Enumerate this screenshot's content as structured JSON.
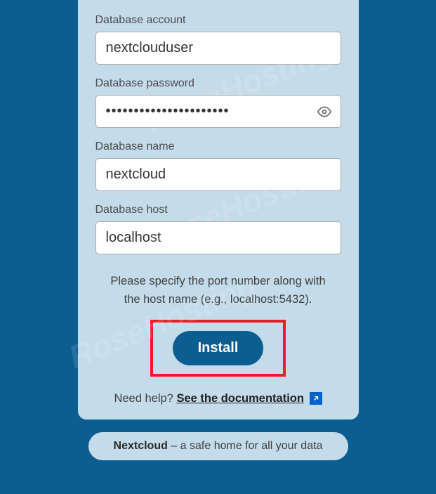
{
  "form": {
    "db_account": {
      "label": "Database account",
      "value": "nextclouduser"
    },
    "db_password": {
      "label": "Database password",
      "value": "••••••••••••••••••••••"
    },
    "db_name": {
      "label": "Database name",
      "value": "nextcloud"
    },
    "db_host": {
      "label": "Database host",
      "value": "localhost"
    },
    "hint": "Please specify the port number along with the host name (e.g., localhost:5432).",
    "install_label": "Install",
    "help_prefix": "Need help? ",
    "help_link": "See the documentation"
  },
  "pill": {
    "brand": "Nextcloud",
    "tagline": " – a safe home for all your data"
  },
  "watermark": "RoseHosting"
}
